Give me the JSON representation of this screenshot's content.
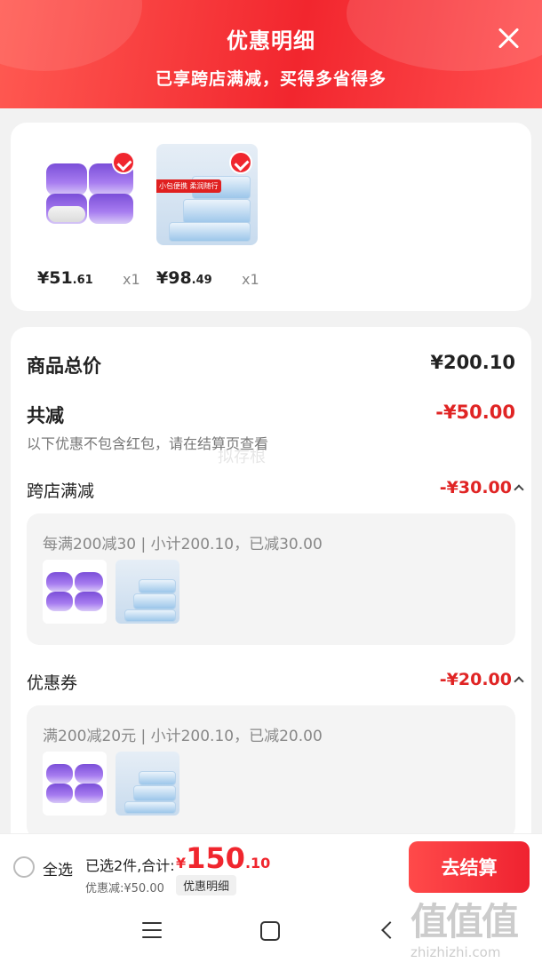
{
  "header": {
    "title": "优惠明细",
    "subtitle": "已享跨店满减，买得多省得多"
  },
  "products": [
    {
      "price_int": "¥51",
      "price_dec": ".61",
      "qty": "x1",
      "image": "tissue-rolls"
    },
    {
      "price_int": "¥98",
      "price_dec": ".49",
      "qty": "x1",
      "image": "wet-wipes",
      "tag": "小包便携 柔润随行"
    }
  ],
  "summary": {
    "total_label": "商品总价",
    "total_value": "¥200.10",
    "reduce_label": "共减",
    "reduce_value": "-¥50.00",
    "note": "以下优惠不包含红包，请在结算页查看",
    "note_color": "#777777",
    "accent": "#e02424"
  },
  "sections": [
    {
      "label": "跨店满减",
      "value": "-¥30.00",
      "detail": "每满200减30 | 小计200.10，已减30.00"
    },
    {
      "label": "优惠券",
      "value": "-¥20.00",
      "detail": "满200减20元 | 小计200.10，已减20.00"
    }
  ],
  "bottom_bar": {
    "select_all": "全选",
    "selected": "已选2件,合计:",
    "total_symbol": "¥",
    "total_int": "150",
    "total_dec": ".10",
    "discount": "优惠减:¥50.00",
    "discount_button": "优惠明细",
    "checkout": "去结算"
  },
  "watermark": {
    "logo": "值值值",
    "site": "zhizhizhi.com",
    "center": "拟存根"
  }
}
